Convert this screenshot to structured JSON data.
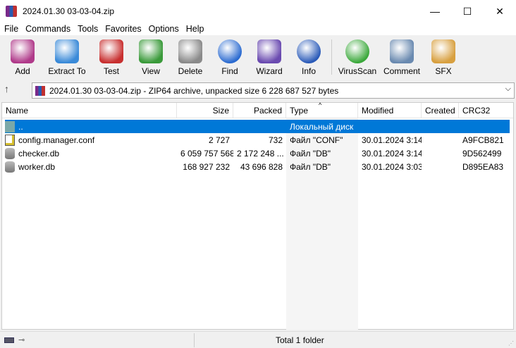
{
  "window": {
    "title": "2024.01.30 03-03-04.zip",
    "minimize": "—",
    "maximize": "☐",
    "close": "✕"
  },
  "menu": [
    "File",
    "Commands",
    "Tools",
    "Favorites",
    "Options",
    "Help"
  ],
  "toolbar": [
    {
      "label": "Add",
      "icon": "add-archive-icon",
      "color": "#b03a8a"
    },
    {
      "label": "Extract To",
      "icon": "extract-folder-icon",
      "color": "#3a8ad8"
    },
    {
      "label": "Test",
      "icon": "test-clipboard-icon",
      "color": "#c83030"
    },
    {
      "label": "View",
      "icon": "view-book-icon",
      "color": "#3a9a3a"
    },
    {
      "label": "Delete",
      "icon": "trash-icon",
      "color": "#8a8a8a"
    },
    {
      "label": "Find",
      "icon": "magnifier-icon",
      "color": "#2a6ad0"
    },
    {
      "label": "Wizard",
      "icon": "wand-icon",
      "color": "#6a4ab0"
    },
    {
      "label": "Info",
      "icon": "info-icon",
      "color": "#2a5ab8"
    },
    {
      "label": "VirusScan",
      "icon": "virus-scan-icon",
      "color": "#3aa83a"
    },
    {
      "label": "Comment",
      "icon": "comment-icon",
      "color": "#6a8ab0"
    },
    {
      "label": "SFX",
      "icon": "sfx-box-icon",
      "color": "#d8a040"
    }
  ],
  "address": {
    "value": "2024.01.30 03-03-04.zip - ZIP64 archive, unpacked size 6 228 687 527 bytes"
  },
  "columns": [
    "Name",
    "Size",
    "Packed",
    "Type",
    "Modified",
    "Created",
    "CRC32"
  ],
  "rows": [
    {
      "name": "..",
      "size": "",
      "packed": "",
      "type": "Локальный диск",
      "modified": "",
      "created": "",
      "crc": "",
      "icon": "folder-up-icon",
      "selected": true
    },
    {
      "name": "config.manager.conf",
      "size": "2 727",
      "packed": "732",
      "type": "Файл \"CONF\"",
      "modified": "30.01.2024 3:14",
      "created": "",
      "crc": "A9FCB821",
      "icon": "text-file-icon"
    },
    {
      "name": "checker.db",
      "size": "6 059 757 568",
      "packed": "2 172 248 ...",
      "type": "Файл \"DB\"",
      "modified": "30.01.2024 3:14",
      "created": "",
      "crc": "9D562499",
      "icon": "database-icon"
    },
    {
      "name": "worker.db",
      "size": "168 927 232",
      "packed": "43 696 828",
      "type": "Файл \"DB\"",
      "modified": "30.01.2024 3:03",
      "created": "",
      "crc": "D895EA83",
      "icon": "database-icon"
    }
  ],
  "status": {
    "text": "Total 1 folder"
  }
}
